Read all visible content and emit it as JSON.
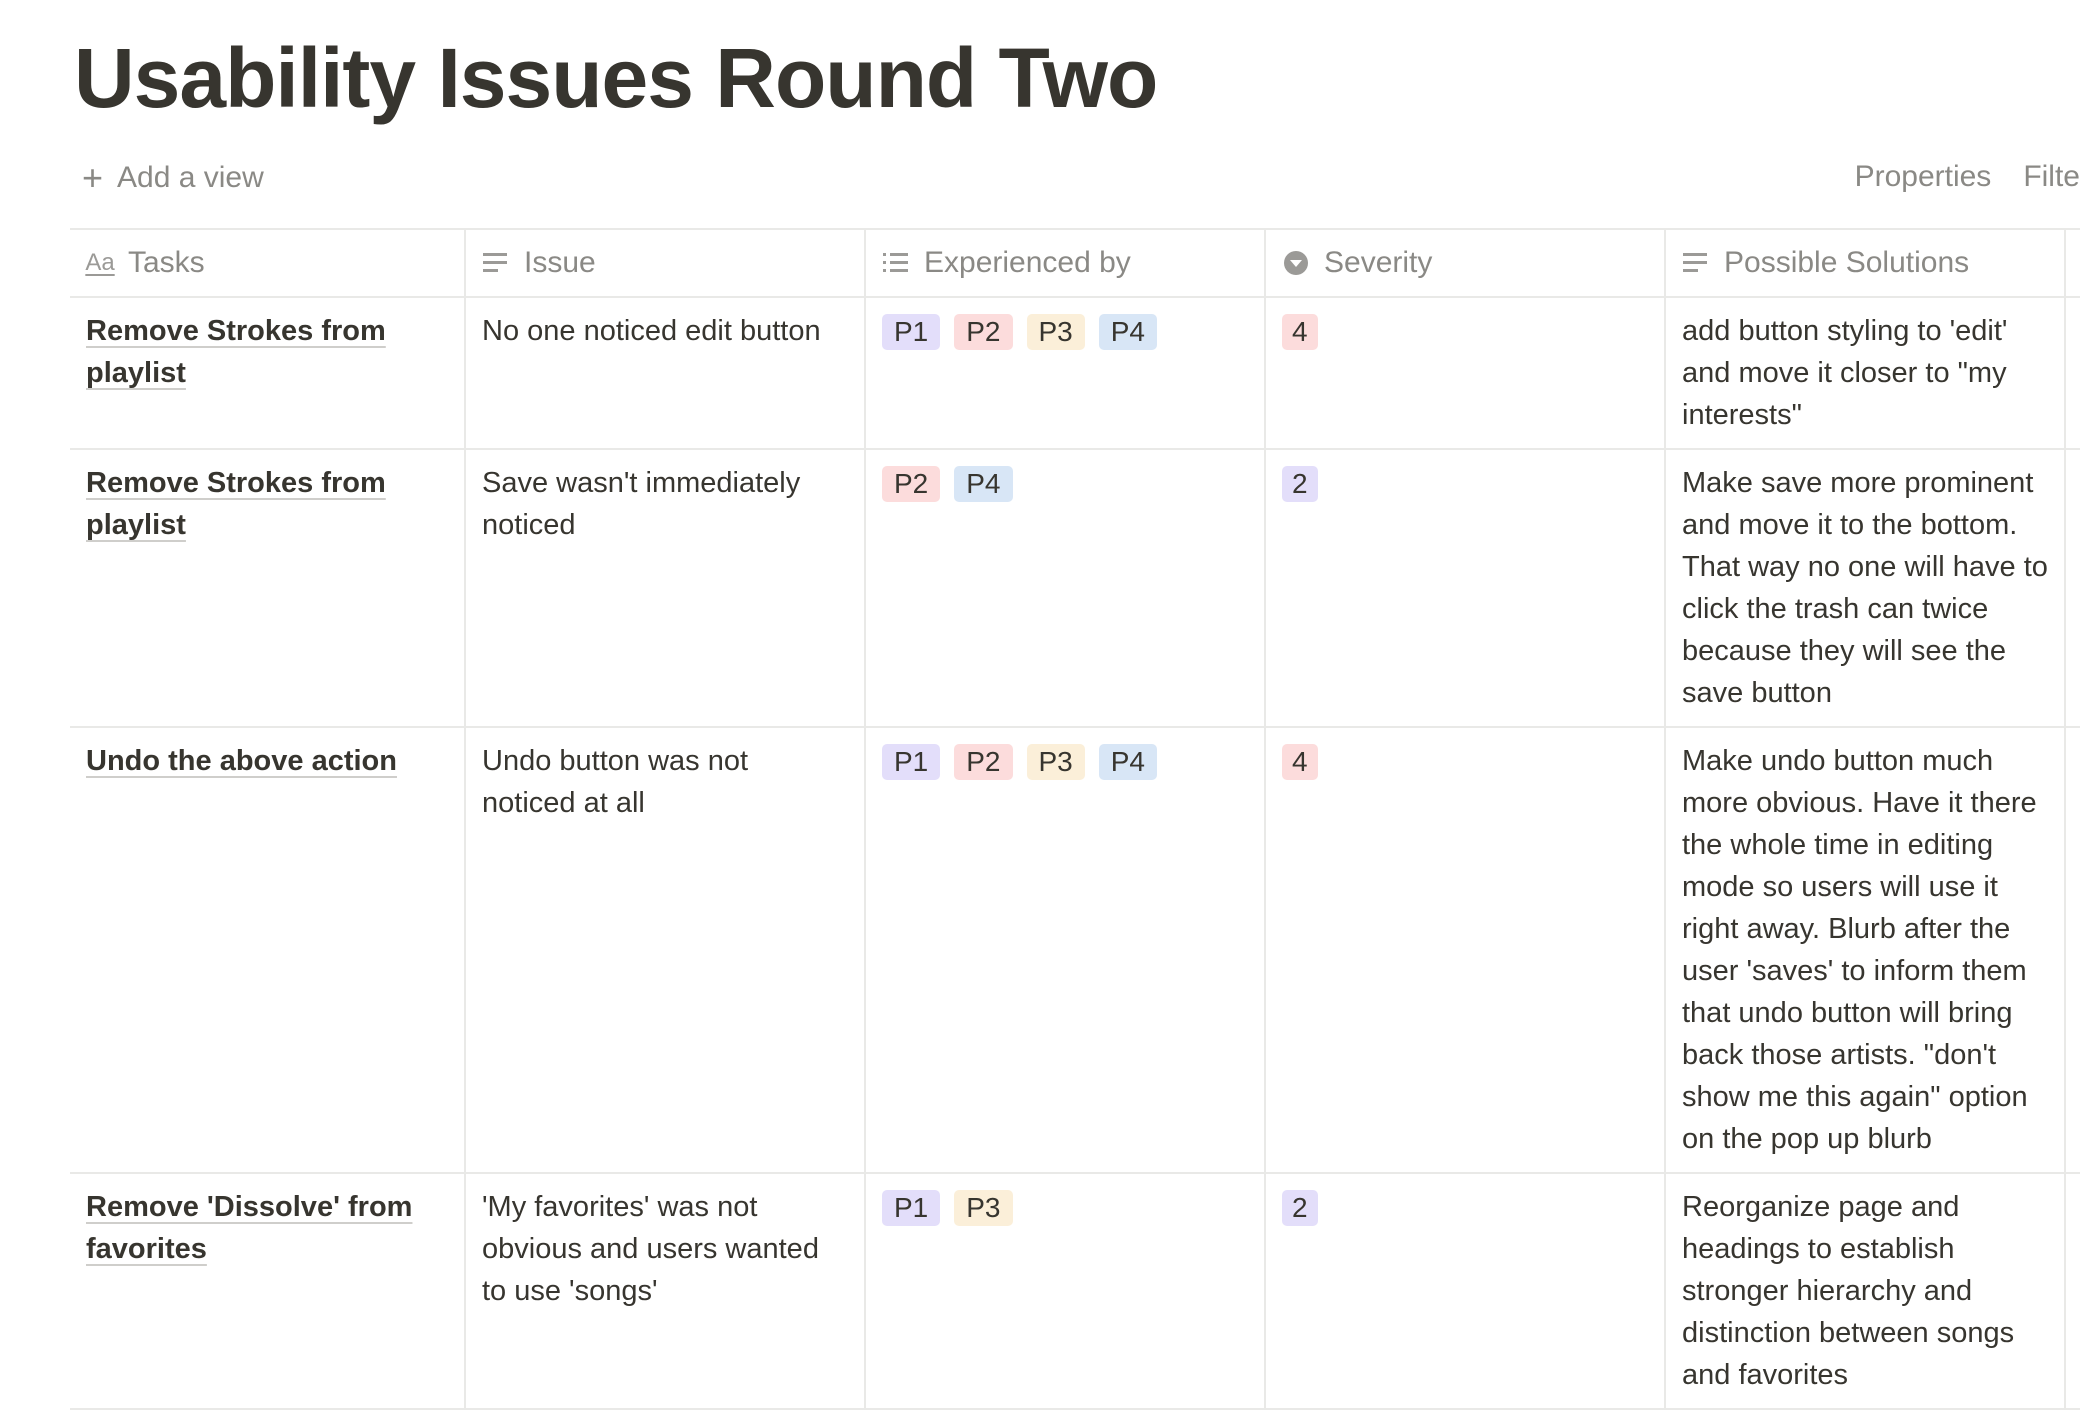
{
  "page": {
    "title": "Usability Issues Round Two"
  },
  "view_bar": {
    "add_view_label": "Add a view",
    "properties_label": "Properties",
    "filter_label": "Filte"
  },
  "columns": {
    "tasks": "Tasks",
    "issue": "Issue",
    "experienced_by": "Experienced by",
    "severity": "Severity",
    "possible_solutions": "Possible Solutions"
  },
  "column_icons": {
    "tasks": "title-property-icon",
    "issue": "text-property-icon",
    "experienced_by": "multi-select-property-icon",
    "severity": "select-property-icon",
    "possible_solutions": "text-property-icon"
  },
  "tag_colors": {
    "P1": "#e3defa",
    "P2": "#fcdcdc",
    "P3": "#fbefd9",
    "P4": "#d8e6f6"
  },
  "rows": [
    {
      "task": "Remove Strokes from playlist",
      "issue": "No one noticed edit button",
      "experienced_by": [
        "P1",
        "P2",
        "P3",
        "P4"
      ],
      "severity": "4",
      "solution": "add button styling to 'edit' and move it closer to \"my interests\""
    },
    {
      "task": "Remove Strokes from playlist",
      "issue": "Save wasn't immediately noticed",
      "experienced_by": [
        "P2",
        "P4"
      ],
      "severity": "2",
      "solution": "Make save more prominent and move it to the bottom. That way no one will have to click the trash can twice because they will see the save button"
    },
    {
      "task": "Undo the above action",
      "issue": "Undo button was not noticed at all",
      "experienced_by": [
        "P1",
        "P2",
        "P3",
        "P4"
      ],
      "severity": "4",
      "solution": "Make undo button much more obvious. Have it there the whole time in editing mode so users will use it right away. Blurb after the user 'saves' to inform them that undo button will bring back those artists. \"don't show me this again\" option on the pop up blurb"
    },
    {
      "task": "Remove 'Dissolve' from favorites",
      "issue": "'My favorites' was not obvious and users wanted to use 'songs'",
      "experienced_by": [
        "P1",
        "P3"
      ],
      "severity": "2",
      "solution": "Reorganize page and headings to establish stronger hierarchy and distinction between songs and favorites"
    }
  ]
}
